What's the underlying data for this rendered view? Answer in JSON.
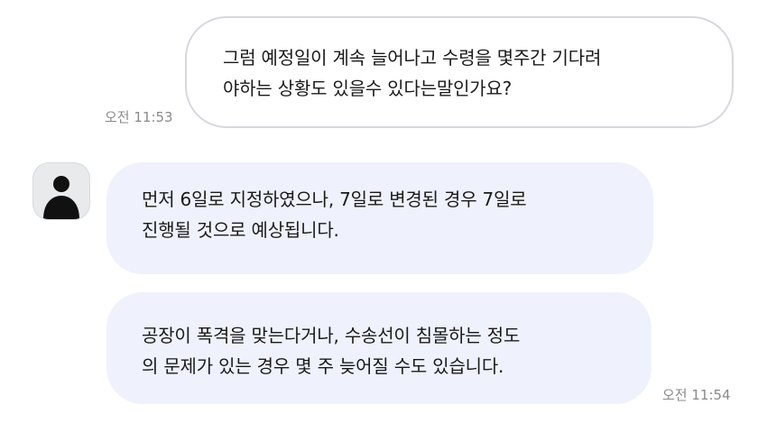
{
  "messages": {
    "outgoing": {
      "lines": [
        "그럼 예정일이 계속 늘어나고 수령을 몇주간 기다려",
        "야하는 상황도 있을수 있다는말인가요?"
      ],
      "time": "오전 11:53"
    },
    "incoming": [
      {
        "lines": [
          "먼저 6일로 지정하였으나, 7일로 변경된 경우 7일로",
          "진행될 것으로 예상됩니다."
        ]
      },
      {
        "lines": [
          "공장이 폭격을 맞는다거나, 수송선이 침몰하는 정도",
          "의 문제가 있는 경우 몇 주 늦어질 수도 있습니다."
        ],
        "time": "오전 11:54"
      }
    ]
  },
  "icons": {
    "avatar": "person-silhouette-icon"
  }
}
